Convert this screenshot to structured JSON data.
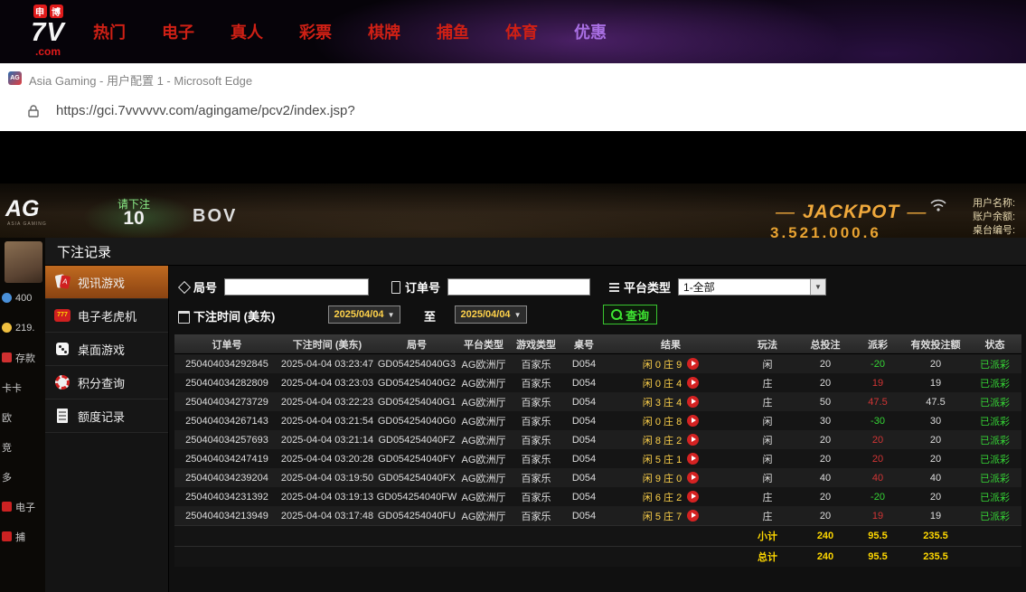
{
  "site_nav": {
    "logo": {
      "tag1": "申",
      "tag2": "博",
      "main": "7V",
      "suffix": ".com"
    },
    "items": [
      {
        "label": "热门",
        "highlight": false
      },
      {
        "label": "电子",
        "highlight": false
      },
      {
        "label": "真人",
        "highlight": false
      },
      {
        "label": "彩票",
        "highlight": false
      },
      {
        "label": "棋牌",
        "highlight": false
      },
      {
        "label": "捕鱼",
        "highlight": false
      },
      {
        "label": "体育",
        "highlight": false
      },
      {
        "label": "优惠",
        "highlight": true
      }
    ]
  },
  "browser": {
    "window_title": "Asia Gaming - 用户配置 1 - Microsoft Edge",
    "favicon": "AG",
    "url": "https://gci.7vvvvvv.com/agingame/pcv2/index.jsp?"
  },
  "scene": {
    "ag_logo": "AG",
    "ag_logo_sub": "ASIA GAMING",
    "bet_prompt": "请下注",
    "countdown": "10",
    "studio": "BOV",
    "jackpot_label": "JACKPOT",
    "jackpot_value": "3,521,000.6",
    "user_info": [
      {
        "label": "用户名称:"
      },
      {
        "label": "账户余额:"
      },
      {
        "label": "桌台编号:"
      }
    ],
    "left_strip": [
      {
        "icon": "level-icon",
        "label": "400"
      },
      {
        "icon": "coin-icon",
        "label": "219."
      },
      {
        "icon": "deposit-icon",
        "label": "存款"
      },
      {
        "icon": "",
        "label": "卡卡"
      },
      {
        "icon": "",
        "label": "欧"
      },
      {
        "icon": "",
        "label": "竞"
      },
      {
        "icon": "",
        "label": "多"
      },
      {
        "icon": "slot-icon",
        "label": "电子"
      },
      {
        "icon": "fish-icon",
        "label": "捕"
      }
    ]
  },
  "modal": {
    "title": "下注记录",
    "menu": [
      {
        "icon": "video-game-icon",
        "label": "视讯游戏",
        "active": true
      },
      {
        "icon": "slot-machine-icon",
        "label": "电子老虎机",
        "active": false
      },
      {
        "icon": "table-game-icon",
        "label": "桌面游戏",
        "active": false
      },
      {
        "icon": "points-icon",
        "label": "积分查询",
        "active": false
      },
      {
        "icon": "ledger-icon",
        "label": "额度记录",
        "active": false
      }
    ],
    "filters": {
      "round_label": "局号",
      "round_value": "",
      "order_label": "订单号",
      "order_value": "",
      "platform_label": "平台类型",
      "platform_value": "1-全部",
      "time_label": "下注时间 (美东)",
      "date_from": "2025/04/04",
      "to_label": "至",
      "date_to": "2025/04/04",
      "search_label": "查询"
    },
    "table": {
      "headers": [
        "订单号",
        "下注时间 (美东)",
        "局号",
        "平台类型",
        "游戏类型",
        "桌号",
        "结果",
        "玩法",
        "总投注",
        "派彩",
        "有效投注额",
        "状态"
      ],
      "rows": [
        {
          "order_id": "250404034292845",
          "time": "2025-04-04 03:23:47",
          "round": "GD054254040G3",
          "platform": "AG欧洲厅",
          "game": "百家乐",
          "table": "D054",
          "result": "闲 0 庄 9",
          "play": "闲",
          "total_bet": "20",
          "payout": "-20",
          "valid_bet": "20",
          "status": "已派彩"
        },
        {
          "order_id": "250404034282809",
          "time": "2025-04-04 03:23:03",
          "round": "GD054254040G2",
          "platform": "AG欧洲厅",
          "game": "百家乐",
          "table": "D054",
          "result": "闲 0 庄 4",
          "play": "庄",
          "total_bet": "20",
          "payout": "19",
          "valid_bet": "19",
          "status": "已派彩"
        },
        {
          "order_id": "250404034273729",
          "time": "2025-04-04 03:22:23",
          "round": "GD054254040G1",
          "platform": "AG欧洲厅",
          "game": "百家乐",
          "table": "D054",
          "result": "闲 3 庄 4",
          "play": "庄",
          "total_bet": "50",
          "payout": "47.5",
          "valid_bet": "47.5",
          "status": "已派彩"
        },
        {
          "order_id": "250404034267143",
          "time": "2025-04-04 03:21:54",
          "round": "GD054254040G0",
          "platform": "AG欧洲厅",
          "game": "百家乐",
          "table": "D054",
          "result": "闲 0 庄 8",
          "play": "闲",
          "total_bet": "30",
          "payout": "-30",
          "valid_bet": "30",
          "status": "已派彩"
        },
        {
          "order_id": "250404034257693",
          "time": "2025-04-04 03:21:14",
          "round": "GD054254040FZ",
          "platform": "AG欧洲厅",
          "game": "百家乐",
          "table": "D054",
          "result": "闲 8 庄 2",
          "play": "闲",
          "total_bet": "20",
          "payout": "20",
          "valid_bet": "20",
          "status": "已派彩"
        },
        {
          "order_id": "250404034247419",
          "time": "2025-04-04 03:20:28",
          "round": "GD054254040FY",
          "platform": "AG欧洲厅",
          "game": "百家乐",
          "table": "D054",
          "result": "闲 5 庄 1",
          "play": "闲",
          "total_bet": "20",
          "payout": "20",
          "valid_bet": "20",
          "status": "已派彩"
        },
        {
          "order_id": "250404034239204",
          "time": "2025-04-04 03:19:50",
          "round": "GD054254040FX",
          "platform": "AG欧洲厅",
          "game": "百家乐",
          "table": "D054",
          "result": "闲 9 庄 0",
          "play": "闲",
          "total_bet": "40",
          "payout": "40",
          "valid_bet": "40",
          "status": "已派彩"
        },
        {
          "order_id": "250404034231392",
          "time": "2025-04-04 03:19:13",
          "round": "GD054254040FW",
          "platform": "AG欧洲厅",
          "game": "百家乐",
          "table": "D054",
          "result": "闲 6 庄 2",
          "play": "庄",
          "total_bet": "20",
          "payout": "-20",
          "valid_bet": "20",
          "status": "已派彩"
        },
        {
          "order_id": "250404034213949",
          "time": "2025-04-04 03:17:48",
          "round": "GD054254040FU",
          "platform": "AG欧洲厅",
          "game": "百家乐",
          "table": "D054",
          "result": "闲 5 庄 7",
          "play": "庄",
          "total_bet": "20",
          "payout": "19",
          "valid_bet": "19",
          "status": "已派彩"
        }
      ],
      "summary": [
        {
          "label": "小计",
          "total_bet": "240",
          "payout": "95.5",
          "valid_bet": "235.5"
        },
        {
          "label": "总计",
          "total_bet": "240",
          "payout": "95.5",
          "valid_bet": "235.5"
        }
      ]
    }
  },
  "colors": {
    "nav_red": "#cf2015",
    "nav_highlight_purple": "#a96fe3",
    "win_red": "#d23535",
    "loss_green": "#35d435",
    "paid_green": "#35d435",
    "total_yellow": "#ffd800",
    "result_yellow": "#ffd24a",
    "date_yellow": "#ffd24a",
    "search_green": "#3ee432"
  }
}
